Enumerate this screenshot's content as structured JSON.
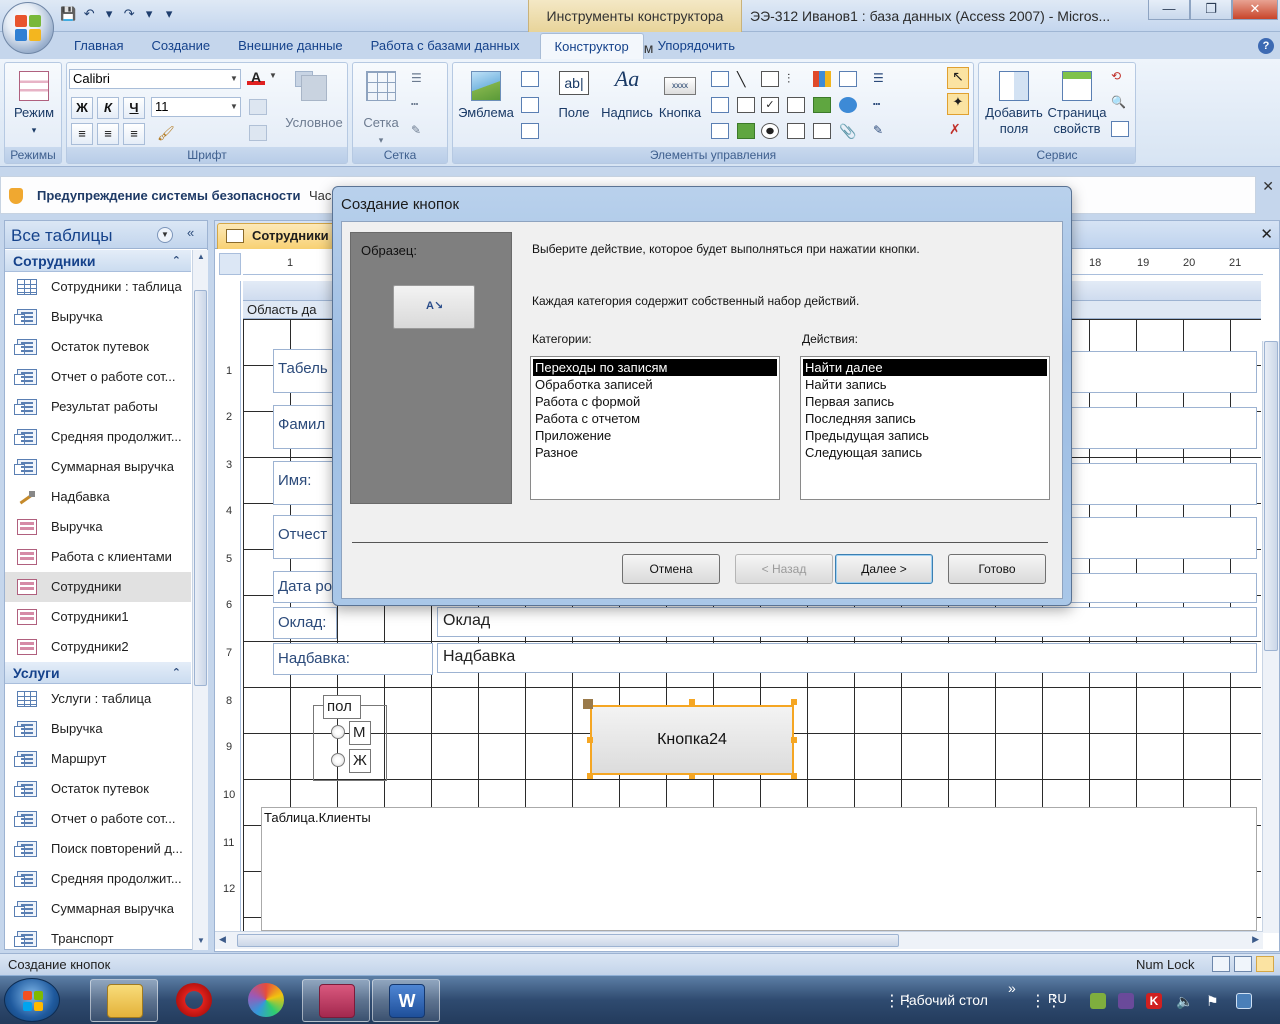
{
  "window": {
    "context_tab_title": "Инструменты конструктора форм",
    "title": "ЭЭ-312 Иванов1 : база данных (Access 2007) - Micros...",
    "controls": {
      "minimize": "—",
      "maximize": "❐",
      "close": "✕"
    }
  },
  "quick_access": {
    "save": "💾",
    "undo": "↶",
    "undo_dd": "▾",
    "redo": "↷",
    "redo_dd": "▾",
    "customize": "▾"
  },
  "ribbon": {
    "tabs": [
      "Главная",
      "Создание",
      "Внешние данные",
      "Работа с базами данных",
      "Конструктор",
      "Упорядочить"
    ],
    "active_tab": "Конструктор",
    "groups": {
      "views": {
        "label": "Режимы",
        "mode_button": "Режим"
      },
      "font": {
        "label": "Шрифт",
        "font_name": "Calibri",
        "font_size": "11",
        "bold": "Ж",
        "italic": "К",
        "underline": "Ч",
        "conditional": "Условное"
      },
      "grid": {
        "label": "Сетка",
        "grid_button": "Сетка"
      },
      "controls": {
        "label": "Элементы управления",
        "emblem": "Эмблема",
        "field": "Поле",
        "caption": "Надпись",
        "button": "Кнопка"
      },
      "service": {
        "label": "Сервис",
        "add_fields": "Добавить поля",
        "property_sheet": "Страница свойств"
      }
    }
  },
  "security_bar": {
    "title": "Предупреждение системы безопасности",
    "subtext": "Час"
  },
  "nav": {
    "header": "Все таблицы",
    "sections": [
      {
        "title": "Сотрудники",
        "items": [
          {
            "label": "Сотрудники : таблица",
            "type": "table"
          },
          {
            "label": "Выручка",
            "type": "query"
          },
          {
            "label": "Остаток путевок",
            "type": "query"
          },
          {
            "label": "Отчет о работе сот...",
            "type": "query"
          },
          {
            "label": "Результат работы",
            "type": "query"
          },
          {
            "label": "Средняя продолжит...",
            "type": "query"
          },
          {
            "label": "Суммарная выручка",
            "type": "query"
          },
          {
            "label": "Надбавка",
            "type": "macro"
          },
          {
            "label": "Выручка",
            "type": "form"
          },
          {
            "label": "Работа с клиентами",
            "type": "form"
          },
          {
            "label": "Сотрудники",
            "type": "form",
            "selected": true
          },
          {
            "label": "Сотрудники1",
            "type": "form"
          },
          {
            "label": "Сотрудники2",
            "type": "form"
          }
        ]
      },
      {
        "title": "Услуги",
        "items": [
          {
            "label": "Услуги : таблица",
            "type": "table"
          },
          {
            "label": "Выручка",
            "type": "query"
          },
          {
            "label": "Маршрут",
            "type": "query"
          },
          {
            "label": "Остаток путевок",
            "type": "query"
          },
          {
            "label": "Отчет о работе сот...",
            "type": "query"
          },
          {
            "label": "Поиск повторений д...",
            "type": "query"
          },
          {
            "label": "Средняя продолжит...",
            "type": "query"
          },
          {
            "label": "Суммарная выручка",
            "type": "query"
          },
          {
            "label": "Транспорт",
            "type": "query"
          }
        ]
      }
    ]
  },
  "document": {
    "tab_label": "Сотрудники",
    "close": "✕",
    "ruler_top": [
      "1",
      "18",
      "19",
      "20",
      "21"
    ],
    "ruler_left": [
      "1",
      "2",
      "3",
      "4",
      "5",
      "6",
      "7",
      "8",
      "9",
      "10",
      "11",
      "12"
    ],
    "section_label": "Область да",
    "labels": {
      "tabel": "Табель",
      "familiya": "Фамил",
      "imya": "Имя:",
      "otchestvo": "Отчест",
      "data": "Дата ро",
      "oklad": "Оклад:",
      "nadbavka": "Надбавка:"
    },
    "fields": {
      "oklad": "Оклад",
      "nadbavka": "Надбавка"
    },
    "option_group": {
      "label": "пол",
      "opt_m": "М",
      "opt_zh": "Ж"
    },
    "button": "Кнопка24",
    "subform": "Таблица.Клиенты"
  },
  "dialog": {
    "title": "Создание кнопок",
    "sample_label": "Образец:",
    "instruction": "Выберите действие, которое будет выполняться при нажатии кнопки.",
    "info": "Каждая категория содержит собственный набор действий.",
    "categories_label": "Категории:",
    "actions_label": "Действия:",
    "categories": [
      "Переходы по записям",
      "Обработка записей",
      "Работа с формой",
      "Работа с отчетом",
      "Приложение",
      "Разное"
    ],
    "actions": [
      "Найти далее",
      "Найти запись",
      "Первая запись",
      "Последняя запись",
      "Предыдущая запись",
      "Следующая запись"
    ],
    "buttons": {
      "cancel": "Отмена",
      "back": "< Назад",
      "next": "Далее >",
      "finish": "Готово"
    }
  },
  "status": {
    "left": "Создание кнопок",
    "right": "Num Lock"
  },
  "taskbar": {
    "desktop": "Рабочий стол",
    "chevron": "»",
    "lang": "RU"
  }
}
